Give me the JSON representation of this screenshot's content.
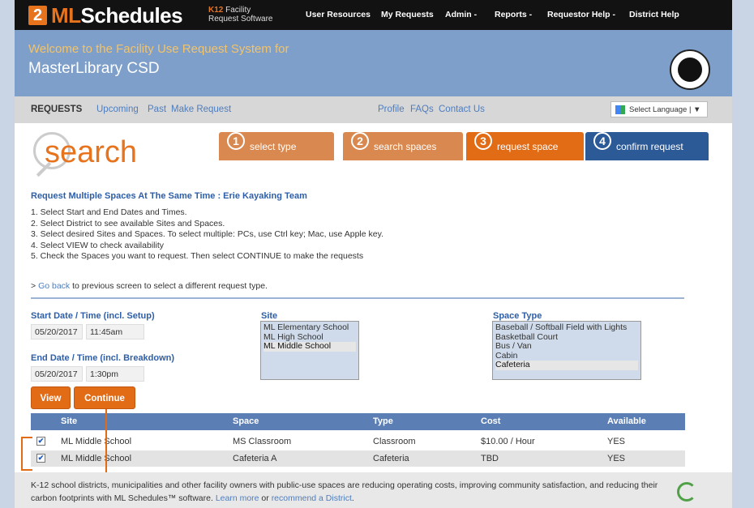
{
  "nav": {
    "logo_box": "2",
    "logo_ml": "ML",
    "logo_rest": "Schedules",
    "logo_k12": "K12",
    "logo_sub1": "Facility",
    "logo_sub2": "Request Software",
    "links": [
      "User Resources",
      "My Requests",
      "Admin -",
      "Reports -",
      "Requestor Help -",
      "District Help"
    ]
  },
  "header": {
    "welcome": "Welcome to the Facility Use Request System for",
    "district": "MasterLibrary CSD"
  },
  "subnav": {
    "requests": "REQUESTS",
    "upcoming": "Upcoming",
    "past": "Past",
    "make": "Make Request",
    "profile": "Profile",
    "faqs": "FAQs",
    "contact": "Contact Us",
    "language": "Select Language | ▼"
  },
  "search_word": "search",
  "steps": [
    {
      "num": "1",
      "label": "select type",
      "color": "#d9894f"
    },
    {
      "num": "2",
      "label": "search spaces",
      "color": "#d9894f"
    },
    {
      "num": "3",
      "label": "request space",
      "color": "#e26b16"
    },
    {
      "num": "4",
      "label": "confirm request",
      "color": "#2c5a96"
    }
  ],
  "request_title": "Request Multiple Spaces At The Same Time : Erie Kayaking Team",
  "instructions": [
    "1. Select Start and End Dates and Times.",
    "2. Select District to see available Sites and Spaces.",
    "3. Select desired Sites and Spaces. To select multiple: PCs, use Ctrl key; Mac, use Apple key.",
    "4. Select VIEW to check availability",
    "5. Check the Spaces you want to request. Then select CONTINUE to make the requests"
  ],
  "goback": {
    "prefix": "> ",
    "link": "Go back",
    "rest": " to previous screen to select a different request type."
  },
  "form": {
    "start_label": "Start Date / Time (incl. Setup)",
    "start_date": "05/20/2017",
    "start_time": "11:45am",
    "end_label": "End Date / Time (incl. Breakdown)",
    "end_date": "05/20/2017",
    "end_time": "1:30pm",
    "site_label": "Site",
    "sites": [
      "ML Elementary School",
      "ML High School",
      "ML Middle School"
    ],
    "site_selected": "ML Middle School",
    "space_type_label": "Space Type",
    "space_types": [
      "Baseball / Softball Field with Lights",
      "Basketball Court",
      "Bus / Van",
      "Cabin",
      "Cafeteria"
    ],
    "space_type_selected": "Cafeteria"
  },
  "buttons": {
    "view": "View",
    "continue": "Continue"
  },
  "table": {
    "headers": [
      "Site",
      "Space",
      "Type",
      "Cost",
      "Available"
    ],
    "rows": [
      {
        "checked": "✔",
        "site": "ML Middle School",
        "space": "MS Classroom",
        "type": "Classroom",
        "cost": "$10.00 / Hour",
        "available": "YES"
      },
      {
        "checked": "✔",
        "site": "ML Middle School",
        "space": "Cafeteria A",
        "type": "Cafeteria",
        "cost": "TBD",
        "available": "YES"
      }
    ]
  },
  "footer": {
    "text1": "K-12 school districts, municipalities and other facility owners with public-use spaces are reducing operating costs, improving community satisfaction, and reducing their carbon footprints with ML Schedules™ software. ",
    "learn": "Learn more",
    "or": " or ",
    "recommend": "recommend a District",
    "end": "."
  }
}
